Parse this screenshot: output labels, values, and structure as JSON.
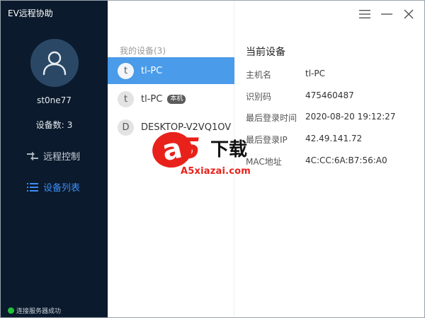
{
  "app": {
    "title": "EV远程协助"
  },
  "sidebar": {
    "username": "st0ne77",
    "device_count_label": "设备数:",
    "device_count": "3",
    "nav": [
      {
        "label": "远程控制",
        "icon": "swap-arrows-icon",
        "active": false
      },
      {
        "label": "设备列表",
        "icon": "list-icon",
        "active": true
      }
    ],
    "status": "连接服务器成功",
    "status_color": "#22c23a"
  },
  "device_list": {
    "header": "我的设备(3)",
    "items": [
      {
        "initial": "t",
        "name": "tl-PC",
        "selected": true,
        "badge": ""
      },
      {
        "initial": "t",
        "name": "tl-PC",
        "selected": false,
        "badge": "本机"
      },
      {
        "initial": "D",
        "name": "DESKTOP-V2VQ1OV",
        "selected": false,
        "badge": ""
      }
    ]
  },
  "detail": {
    "title": "当前设备",
    "rows": [
      {
        "key": "主机名",
        "value": "tl-PC"
      },
      {
        "key": "识别码",
        "value": "475460487"
      },
      {
        "key": "最后登录时间",
        "value": "2020-08-20 19:12:27"
      },
      {
        "key": "最后登录IP",
        "value": "42.49.141.72"
      },
      {
        "key": "MAC地址",
        "value": "4C:CC:6A:B7:56:A0"
      }
    ]
  },
  "watermark": {
    "glyph_a": "a",
    "glyph_5": "5",
    "text": "下载",
    "domain": "A5xiazai.com"
  },
  "colors": {
    "sidebar_bg": "#0b1a2c",
    "accent": "#3d8ef5",
    "selected_row": "#4a9be9"
  }
}
